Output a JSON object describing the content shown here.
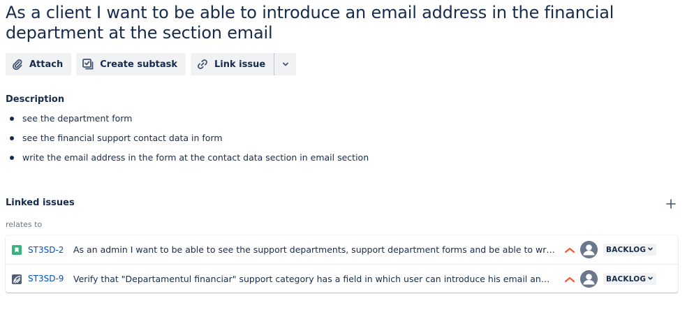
{
  "issue": {
    "title": "As a client I want to be able to introduce an email address in the financial department at the section email"
  },
  "toolbar": {
    "attach_label": "Attach",
    "create_subtask_label": "Create subtask",
    "link_issue_label": "Link issue",
    "attach_icon": "paperclip-icon",
    "subtask_icon": "subtask-icon",
    "link_icon": "link-icon"
  },
  "description": {
    "heading": "Description",
    "items": [
      "see the department form",
      "see the financial support contact data in form",
      "write the email address in the form at the contact data section in email section"
    ]
  },
  "linked_issues": {
    "heading": "Linked issues",
    "relation": "relates to",
    "items": [
      {
        "key": "ST3SD-2",
        "type_icon": "story-icon",
        "summary": "As an admin I want to be able to see the support departments, support department forms and be able to write...",
        "priority": "high",
        "status": "BACKLOG"
      },
      {
        "key": "ST3SD-9",
        "type_icon": "test-icon",
        "summary": "Verify that \"Departamentul financiar\" support category has a field in which user can introduce his email and it's...",
        "priority": "high",
        "status": "BACKLOG"
      }
    ]
  },
  "colors": {
    "link": "#0052cc",
    "text": "#172b4d",
    "subtle": "#6b778c",
    "priority_high": "#ff5630",
    "story": "#36b37e",
    "button_bg": "#f1f2f4"
  }
}
